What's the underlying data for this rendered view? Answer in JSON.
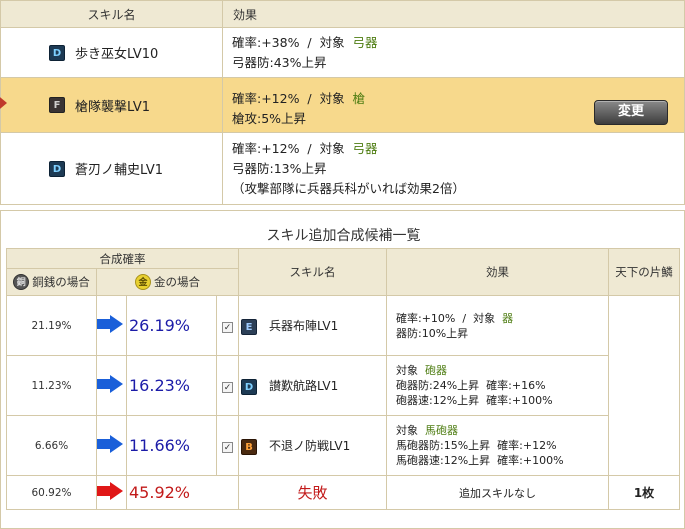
{
  "top": {
    "header_skill": "スキル名",
    "header_effect": "効果",
    "change_label": "変更",
    "skills": [
      {
        "rank": "D",
        "name": "歩き巫女LV10",
        "line1_pre": "確率:+38%  /  対象  ",
        "line1_hl": "弓器",
        "line2": "弓器防:43%上昇",
        "line3": ""
      },
      {
        "rank": "F",
        "name": "槍隊襲撃LV1",
        "line1_pre": "確率:+12%  /  対象  ",
        "line1_hl": "槍",
        "line2": "槍攻:5%上昇",
        "line3": ""
      },
      {
        "rank": "D",
        "name": "蒼刃ノ輔史LV1",
        "line1_pre": "確率:+12%  /  対象  ",
        "line1_hl": "弓器",
        "line2": "弓器防:13%上昇",
        "line3": "（攻撃部隊に兵器兵科がいれば効果2倍）"
      }
    ]
  },
  "candidates": {
    "title": "スキル追加合成候補一覧",
    "header_rate": "合成確率",
    "header_copper": "銅銭の場合",
    "header_gold": "金の場合",
    "header_skill": "スキル名",
    "header_effect": "効果",
    "header_tenka": "天下の片鱗",
    "coin_copper": "銅",
    "coin_gold": "金",
    "check_mark": "✓",
    "rows": [
      {
        "copper": "21.19%",
        "gold": "26.19%",
        "rank": "E",
        "name": "兵器布陣LV1",
        "e1_pre": "確率:+10%  /  対象  ",
        "e1_hl": "器",
        "e2": "器防:10%上昇",
        "e3": ""
      },
      {
        "copper": "11.23%",
        "gold": "16.23%",
        "rank": "D",
        "name": "讃歎航路LV1",
        "e1_pre": "対象  ",
        "e1_hl": "砲器",
        "e2": "砲器防:24%上昇  確率:+16%",
        "e3": "砲器速:12%上昇  確率:+100%"
      },
      {
        "copper": "6.66%",
        "gold": "11.66%",
        "rank": "B",
        "name": "不退ノ防戦LV1",
        "e1_pre": "対象  ",
        "e1_hl": "馬砲器",
        "e2": "馬砲器防:15%上昇  確率:+12%",
        "e3": "馬砲器速:12%上昇  確率:+100%"
      }
    ],
    "fail_row": {
      "copper": "60.92%",
      "gold": "45.92%",
      "label": "失敗",
      "effect": "追加スキルなし",
      "tenka": "1枚"
    }
  }
}
